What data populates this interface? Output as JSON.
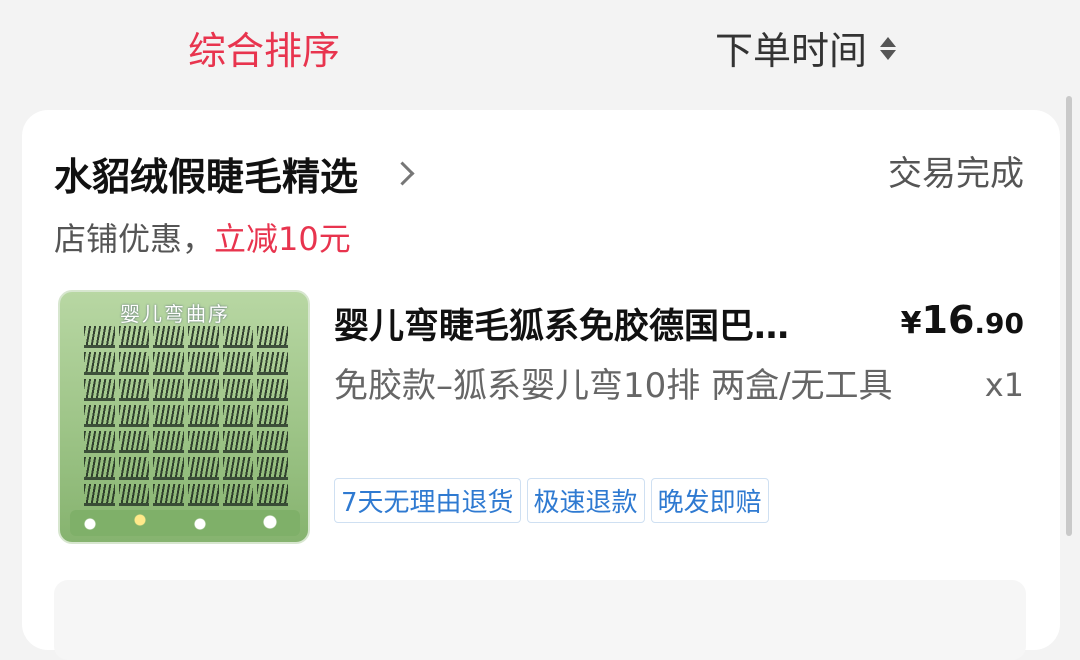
{
  "sort": {
    "option_1": "综合排序",
    "option_2": "下单时间",
    "sort_icon": "sort-up-down-icon",
    "active_color": "#e8344e"
  },
  "order": {
    "shop_name": "水貂绒假睫毛精选",
    "status": "交易完成",
    "promo_prefix": "店铺优惠，",
    "promo_highlight": "立减10元",
    "product": {
      "image_label": "婴儿弯曲序",
      "title": "婴儿弯睫毛狐系免胶德国巴…",
      "price_currency": "¥",
      "price_int": "16",
      "price_dec": ".90",
      "spec": "免胶款–狐系婴儿弯10排 两盒/无工具",
      "qty": "x1",
      "tags": [
        "7天无理由退货",
        "极速退款",
        "晚发即赔"
      ]
    }
  }
}
